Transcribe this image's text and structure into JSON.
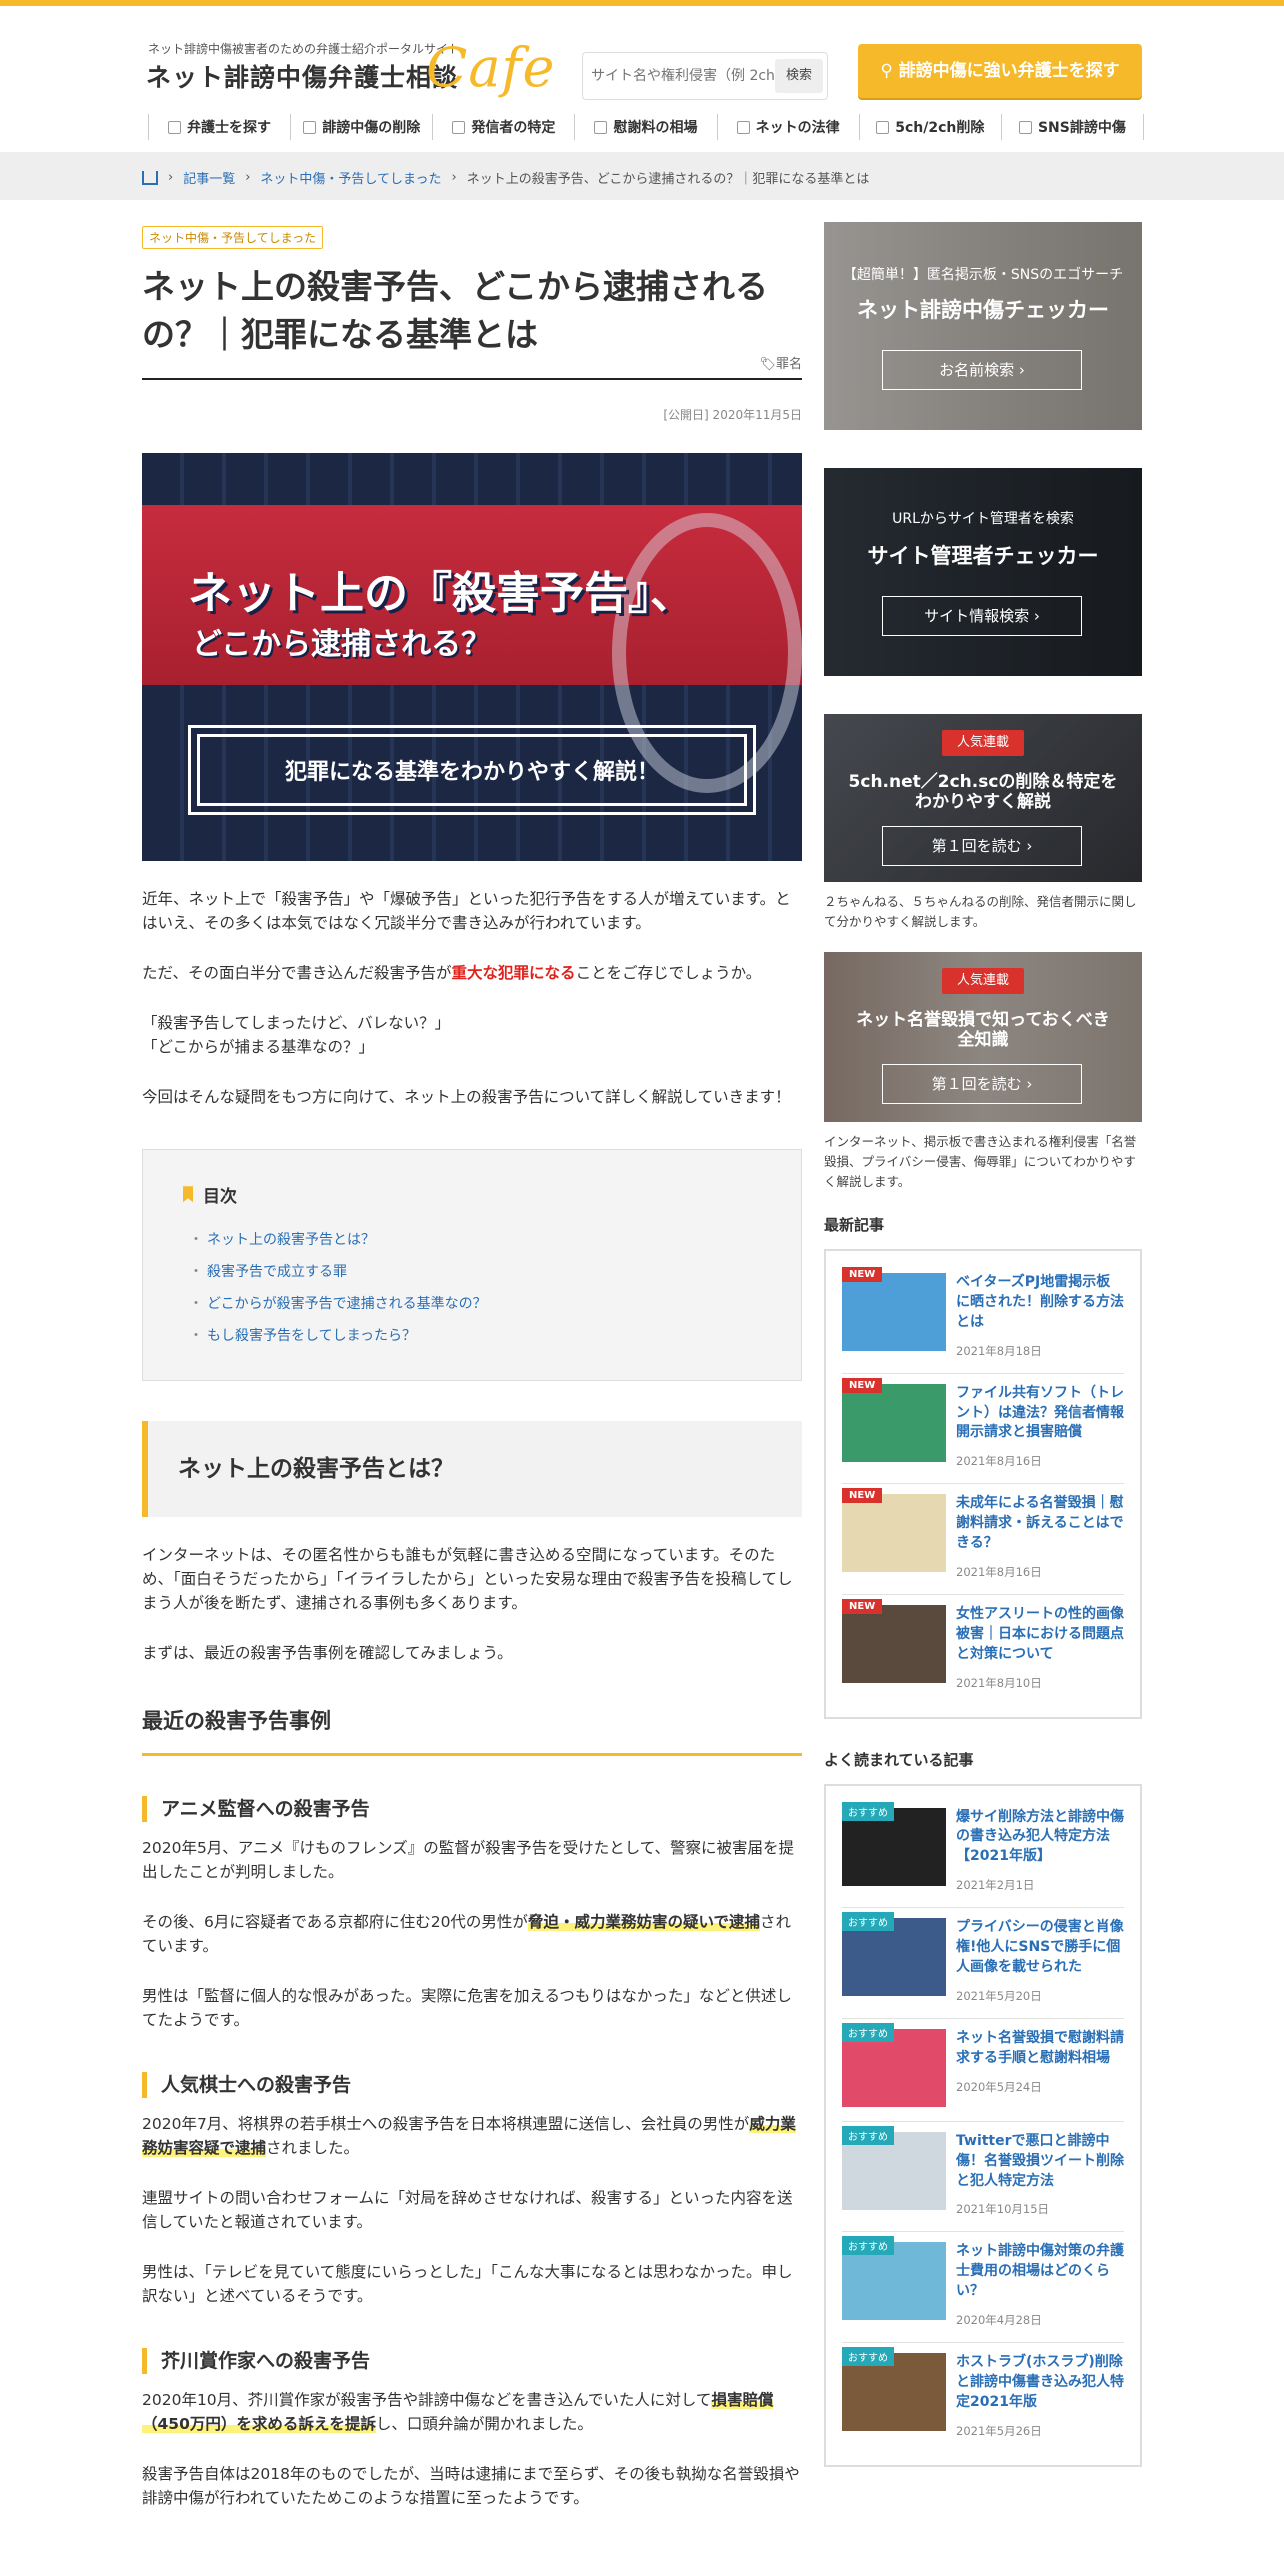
{
  "header": {
    "logo_tagline": "ネット誹謗中傷被害者のための弁護士紹介ポータルサイト",
    "logo_main": "ネット誹謗中傷弁護士相談",
    "logo_cafe": "Cafe",
    "search_placeholder": "サイト名や権利侵害（例 2ch）",
    "search_button": "検索",
    "cta": "誹謗中傷に強い弁護士を探す"
  },
  "nav": [
    {
      "label": "弁護士を探す",
      "icon": "user-icon"
    },
    {
      "label": "誹謗中傷の削除",
      "icon": "fire-icon"
    },
    {
      "label": "発信者の特定",
      "icon": "person-icon"
    },
    {
      "label": "慰謝料の相場",
      "icon": "scale-icon"
    },
    {
      "label": "ネットの法律",
      "icon": "document-icon"
    },
    {
      "label": "5ch/2ch削除",
      "icon": "chat-icon"
    },
    {
      "label": "SNS誹謗中傷",
      "icon": "bubble-icon"
    }
  ],
  "breadcrumb": {
    "items": [
      "記事一覧",
      "ネット中傷・予告してしまった",
      "ネット上の殺害予告、どこから逮捕されるの？｜犯罪になる基準とは"
    ]
  },
  "article": {
    "category": "ネット中傷・予告してしまった",
    "title": "ネット上の殺害予告、どこから逮捕されるの？｜犯罪になる基準とは",
    "tag": "罪名",
    "pubdate": "[公開日] 2020年11月5日",
    "hero": {
      "line1": "ネット上の『殺害予告』、",
      "line2": "どこから逮捕される？",
      "banner": "犯罪になる基準をわかりやすく解説！"
    },
    "intro1": "近年、ネット上で「殺害予告」や「爆破予告」といった犯行予告をする人が増えています。とはいえ、その多くは本気ではなく冗談半分で書き込みが行われています。",
    "intro2_pre": "ただ、その面白半分で書き込んだ殺害予告が",
    "intro2_red": "重大な犯罪になる",
    "intro2_post": "ことをご存じでしょうか。",
    "intro3a": "「殺害予告してしまったけど、バレない？」",
    "intro3b": "「どこからが捕まる基準なの？」",
    "intro4": "今回はそんな疑問をもつ方に向けて、ネット上の殺害予告について詳しく解説していきます！",
    "toc": {
      "heading": "目次",
      "items": [
        "ネット上の殺害予告とは？",
        "殺害予告で成立する罪",
        "どこからが殺害予告で逮捕される基準なの？",
        "もし殺害予告をしてしまったら？"
      ]
    },
    "sec1": "ネット上の殺害予告とは？",
    "sec1_p1": "インターネットは、その匿名性からも誰もが気軽に書き込める空間になっています。そのため、「面白そうだったから」「イライラしたから」といった安易な理由で殺害予告を投稿してしまう人が後を断たず、逮捕される事例も多くあります。",
    "sec1_p2": "まずは、最近の殺害予告事例を確認してみましょう。",
    "sub1": "最近の殺害予告事例",
    "case1": {
      "title": "アニメ監督への殺害予告",
      "p1": "2020年5月、アニメ『けものフレンズ』の監督が殺害予告を受けたとして、警察に被害届を提出したことが判明しました。",
      "p2_pre": "その後、6月に容疑者である京都府に住む20代の男性が",
      "p2_hl": "脅迫・威力業務妨害の疑いで逮捕",
      "p2_post": "されています。",
      "p3": "男性は「監督に個人的な恨みがあった。実際に危害を加えるつもりはなかった」などと供述してたようです。"
    },
    "case2": {
      "title": "人気棋士への殺害予告",
      "p1_pre": "2020年7月、将棋界の若手棋士への殺害予告を日本将棋連盟に送信し、会社員の男性が",
      "p1_hl": "威力業務妨害容疑で逮捕",
      "p1_post": "されました。",
      "p2": "連盟サイトの問い合わせフォームに「対局を辞めさせなければ、殺害する」といった内容を送信していたと報道されています。",
      "p3": "男性は、「テレビを見ていて態度にいらっとした」「こんな大事になるとは思わなかった。申し訳ない」と述べているそうです。"
    },
    "case3": {
      "title": "芥川賞作家への殺害予告",
      "p1_pre": "2020年10月、芥川賞作家が殺害予告や誹謗中傷などを書き込んでいた人に対して",
      "p1_hl": "損害賠償（450万円）を求める訴えを提訴",
      "p1_post": "し、口頭弁論が開かれました。",
      "p2": "殺害予告自体は2018年のものでしたが、当時は逮捕にまで至らず、その後も執拗な名誉毀損や誹謗中傷が行われていたためこのような措置に至ったようです。"
    }
  },
  "sidebar": {
    "w1": {
      "small": "【超簡単！】匿名掲示板・SNSのエゴサーチ",
      "large": "ネット誹謗中傷チェッカー",
      "button": "お名前検索"
    },
    "w2": {
      "small": "URLからサイト管理者を検索",
      "large": "サイト管理者チェッカー",
      "button": "サイト情報検索"
    },
    "w3": {
      "badge": "人気連載",
      "title": "5ch.net／2ch.scの削除＆特定をわかりやすく解説",
      "button": "第１回を読む",
      "desc": "２ちゃんねる、５ちゃんねるの削除、発信者開示に関して分かりやすく解説します。"
    },
    "w4": {
      "badge": "人気連載",
      "title": "ネット名誉毀損で知っておくべき全知識",
      "button": "第１回を読む",
      "desc": "インターネット、掲示板で書き込まれる権利侵害「名誉毀損、プライバシー侵害、侮辱罪」についてわかりやすく解説します。"
    },
    "latest_heading": "最新記事",
    "latest": [
      {
        "badge": "NEW",
        "title": "ベイターズPJ地雷掲示板に晒された！削除する方法とは",
        "date": "2021年8月18日",
        "thumb_color": "#4e9fd8"
      },
      {
        "badge": "NEW",
        "title": "ファイル共有ソフト（トレント）は違法？発信者情報開示請求と損害賠償",
        "date": "2021年8月16日",
        "thumb_color": "#3a9a6a"
      },
      {
        "badge": "NEW",
        "title": "未成年による名誉毀損｜慰謝料請求・訴えることはできる？",
        "date": "2021年8月16日",
        "thumb_color": "#e6d8b0"
      },
      {
        "badge": "NEW",
        "title": "女性アスリートの性的画像被害｜日本における問題点と対策について",
        "date": "2021年8月10日",
        "thumb_color": "#5a4a3e"
      }
    ],
    "popular_heading": "よく読まれている記事",
    "popular": [
      {
        "badge": "おすすめ",
        "title": "爆サイ削除方法と誹謗中傷の書き込み犯人特定方法【2021年版】",
        "date": "2021年2月1日",
        "thumb_color": "#222222"
      },
      {
        "badge": "おすすめ",
        "title": "プライバシーの侵害と肖像権!他人にSNSで勝手に個人画像を載せられた",
        "date": "2021年5月20日",
        "thumb_color": "#3c5a8a"
      },
      {
        "badge": "おすすめ",
        "title": "ネット名誉毀損で慰謝料請求する手順と慰謝料相場",
        "date": "2020年5月24日",
        "thumb_color": "#e24a6a"
      },
      {
        "badge": "おすすめ",
        "title": "Twitterで悪口と誹謗中傷！名誉毀損ツイート削除と犯人特定方法",
        "date": "2021年10月15日",
        "thumb_color": "#cfd8de"
      },
      {
        "badge": "おすすめ",
        "title": "ネット誹謗中傷対策の弁護士費用の相場はどのくらい？",
        "date": "2020年4月28日",
        "thumb_color": "#6fb8d8"
      },
      {
        "badge": "おすすめ",
        "title": "ホストラブ(ホスラブ)削除と誹謗中傷書き込み犯人特定2021年版",
        "date": "2021年5月26日",
        "thumb_color": "#7a5a3a"
      }
    ]
  }
}
